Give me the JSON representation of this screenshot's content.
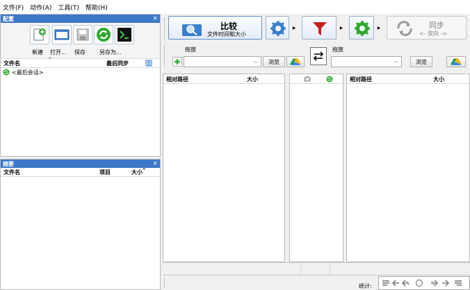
{
  "menu": {
    "file": "文件(F)",
    "action": "动作(A)",
    "tools": "工具(T)",
    "help": "帮助(H)"
  },
  "config_panel": {
    "title": "配置",
    "close": "×",
    "toolbar": {
      "new": "新建",
      "open": "打开...",
      "save": "保存",
      "save_as": "另存为..."
    },
    "columns": {
      "filename": "文件名",
      "last_sync": "最后同步"
    },
    "session_label": "<最后会话>"
  },
  "summary_panel": {
    "title": "摘要",
    "close": "×",
    "columns": {
      "filename": "文件名",
      "items": "项目",
      "size": "大小"
    }
  },
  "compare_button": {
    "label": "比较",
    "sub": "文件时间和大小"
  },
  "sync_button": {
    "label": "同步",
    "sub": "<- 双向 ->"
  },
  "left_folder": {
    "drop_label": "拖放",
    "browse": "浏览"
  },
  "right_folder": {
    "drop_label": "拖放",
    "browse": "浏览"
  },
  "grid_left": {
    "col_path": "相对路径",
    "col_size": "大小"
  },
  "grid_right": {
    "col_path": "相对路径",
    "col_size": "大小"
  },
  "status": {
    "stats_label": "统计:"
  },
  "colors": {
    "panel_title": "#3c78c8",
    "accent_green": "#2ea82e",
    "filter_red": "#c81e1e",
    "settings_blue": "#3a7fd0"
  }
}
